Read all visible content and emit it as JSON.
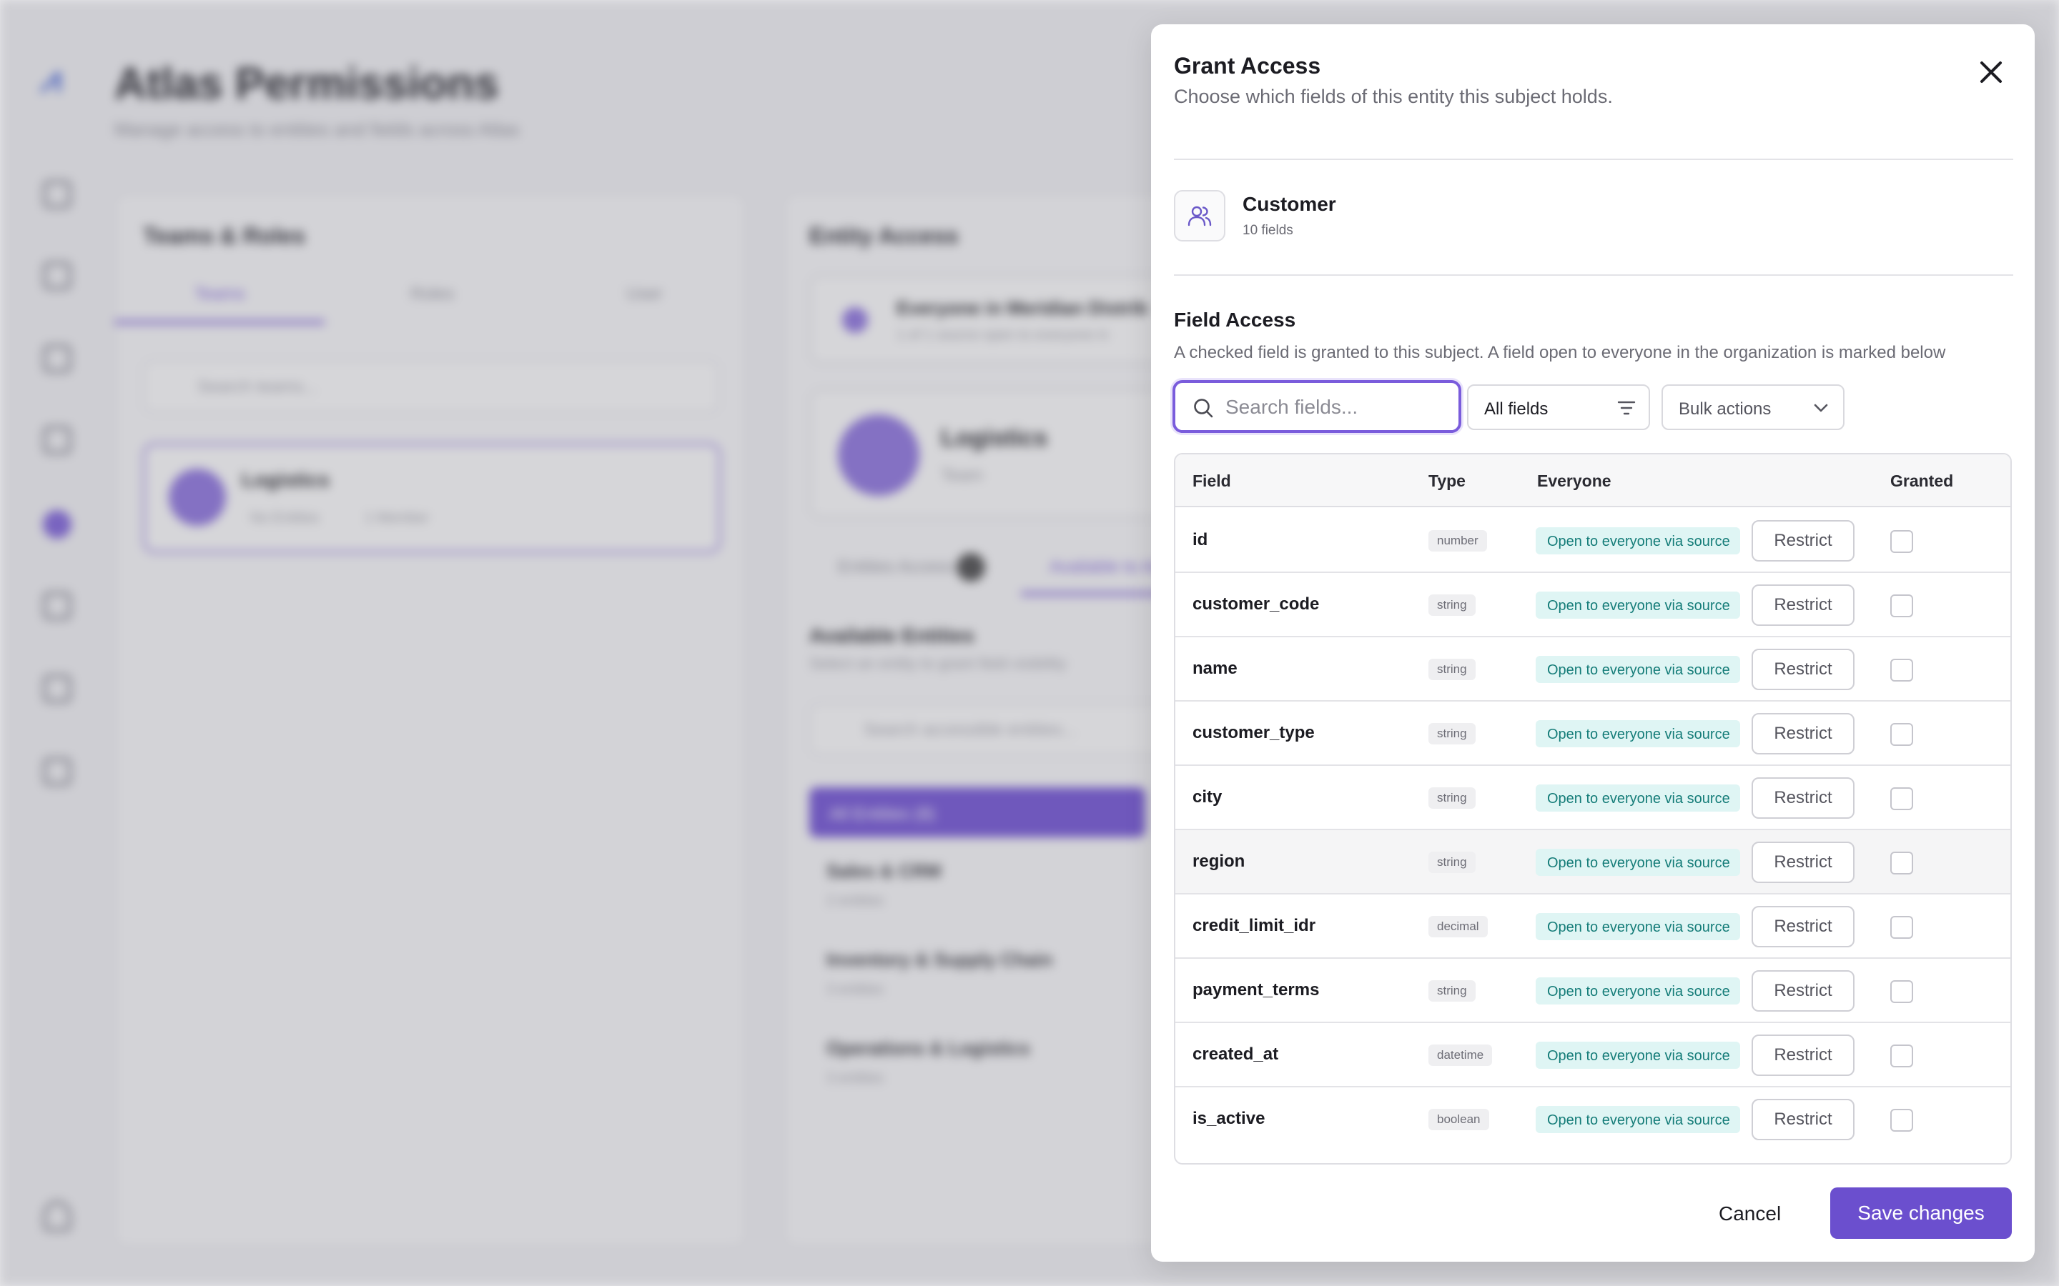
{
  "background": {
    "app_title": "Atlas Permissions",
    "app_subtitle": "Manage access to entities and fields across Atlas",
    "left_panel": {
      "title": "Teams & Roles",
      "tabs": [
        "Teams",
        "Roles",
        "User"
      ],
      "search_placeholder": "Search teams...",
      "selected_team": {
        "name": "Logistics",
        "badge": "No Entities",
        "members": "1 Member"
      }
    },
    "right_panel": {
      "title": "Entity Access",
      "banner_title": "Everyone in Meridian Distrib",
      "banner_sub": "1 of 1 source open to everyone in",
      "team_name": "Logistics",
      "team_type": "Team",
      "tabs": [
        "Entities Access",
        "Available to Ad"
      ],
      "tab_count": "0",
      "available_title": "Available Entities",
      "available_sub": "Select an entity to grant field visibility",
      "search_placeholder": "Search accessible entities...",
      "all_entities": "All Entities (8)",
      "groups": [
        {
          "name": "Sales & CRM",
          "count": "2 entities"
        },
        {
          "name": "Inventory & Supply Chain",
          "count": "3 entities"
        },
        {
          "name": "Operations & Logistics",
          "count": "3 entities"
        }
      ]
    }
  },
  "drawer": {
    "title": "Grant Access",
    "subtitle": "Choose which fields of this entity this subject holds.",
    "entity": {
      "name": "Customer",
      "field_count": "10 fields"
    },
    "field_access": {
      "title": "Field Access",
      "description": "A checked field is granted to this subject. A field open to everyone in the organization is marked below"
    },
    "search": {
      "placeholder": "Search fields...",
      "value": ""
    },
    "filter": {
      "selected": "All fields"
    },
    "bulk": {
      "label": "Bulk actions"
    },
    "table": {
      "columns": [
        "Field",
        "Type",
        "Everyone",
        "Granted"
      ],
      "rows": [
        {
          "field": "id",
          "type": "number",
          "everyone": "Open to everyone via source",
          "action": "Restrict",
          "granted": false
        },
        {
          "field": "customer_code",
          "type": "string",
          "everyone": "Open to everyone via source",
          "action": "Restrict",
          "granted": false
        },
        {
          "field": "name",
          "type": "string",
          "everyone": "Open to everyone via source",
          "action": "Restrict",
          "granted": false
        },
        {
          "field": "customer_type",
          "type": "string",
          "everyone": "Open to everyone via source",
          "action": "Restrict",
          "granted": false
        },
        {
          "field": "city",
          "type": "string",
          "everyone": "Open to everyone via source",
          "action": "Restrict",
          "granted": false
        },
        {
          "field": "region",
          "type": "string",
          "everyone": "Open to everyone via source",
          "action": "Restrict",
          "granted": false
        },
        {
          "field": "credit_limit_idr",
          "type": "decimal",
          "everyone": "Open to everyone via source",
          "action": "Restrict",
          "granted": false
        },
        {
          "field": "payment_terms",
          "type": "string",
          "everyone": "Open to everyone via source",
          "action": "Restrict",
          "granted": false
        },
        {
          "field": "created_at",
          "type": "datetime",
          "everyone": "Open to everyone via source",
          "action": "Restrict",
          "granted": false
        },
        {
          "field": "is_active",
          "type": "boolean",
          "everyone": "Open to everyone via source",
          "action": "Restrict",
          "granted": false
        }
      ]
    },
    "footer": {
      "cancel": "Cancel",
      "save": "Save changes"
    }
  },
  "colors": {
    "accent": "#6b4fce",
    "everyone_badge_bg": "#dff5f4",
    "everyone_badge_text": "#147c78"
  }
}
